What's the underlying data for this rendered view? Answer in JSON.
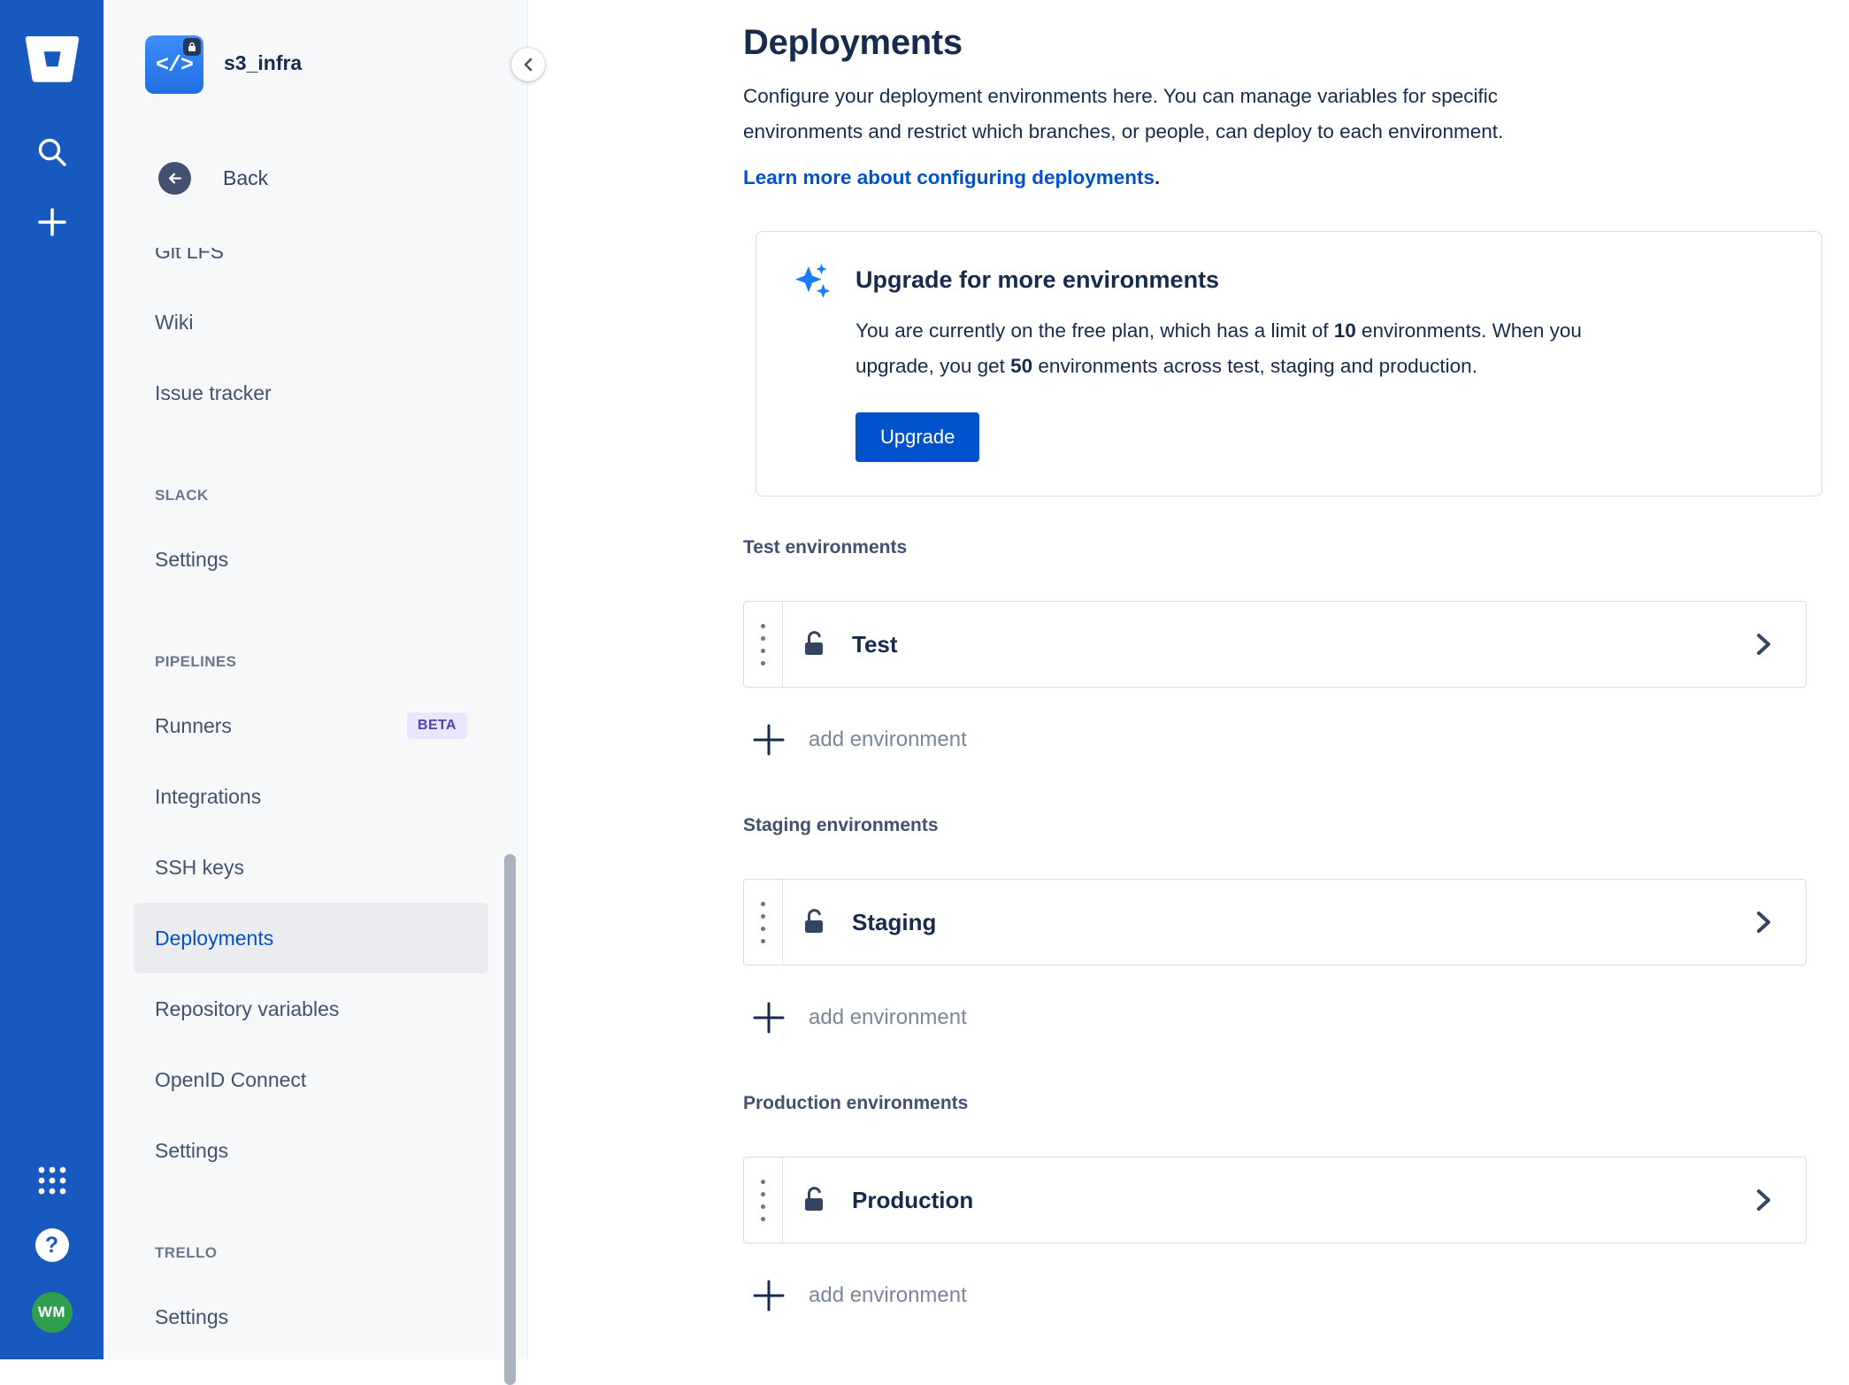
{
  "colors": {
    "rail_blue": "#1759BE",
    "accent_blue": "#0052CC",
    "heading_text": "#172B4D",
    "muted_text": "#6B778C",
    "beta_badge_bg": "#EAE6FF",
    "beta_badge_text": "#5243AA",
    "avatar_green": "#2E9E4F",
    "repo_avatar_blue": "#2684FF",
    "sparkle_blue": "#1D7AFC",
    "selected_item_bg": "#EBECF0"
  },
  "app_rail": {
    "logo": "bitbucket-logo",
    "icons": [
      "search-icon",
      "create-plus-icon",
      "apps-grid-icon",
      "help-icon"
    ],
    "avatar_initials": "WM"
  },
  "sidebar": {
    "repo_name": "s3_infra",
    "repo_avatar_glyph": "</>",
    "back_label": "Back",
    "top_items": [
      "Git LFS",
      "Wiki",
      "Issue tracker"
    ],
    "sections": [
      {
        "header": "SLACK",
        "items": [
          {
            "label": "Settings"
          }
        ]
      },
      {
        "header": "PIPELINES",
        "items": [
          {
            "label": "Runners",
            "badge": "BETA"
          },
          {
            "label": "Integrations"
          },
          {
            "label": "SSH keys"
          },
          {
            "label": "Deployments",
            "selected": true
          },
          {
            "label": "Repository variables"
          },
          {
            "label": "OpenID Connect"
          },
          {
            "label": "Settings"
          }
        ]
      },
      {
        "header": "TRELLO",
        "items": [
          {
            "label": "Settings"
          }
        ]
      }
    ]
  },
  "main": {
    "title": "Deployments",
    "description": "Configure your deployment environments here. You can manage variables for specific environments and restrict which branches, or people, can deploy to each environment.",
    "learn_more_link": "Learn more about configuring deployments",
    "learn_more_suffix": ".",
    "upgrade_card": {
      "title": "Upgrade for more environments",
      "body": {
        "seg1": "You are currently on the free plan, which has a limit of ",
        "free_limit": "10",
        "seg2": " environments. When you upgrade, you get ",
        "upgrade_limit": "50",
        "seg3": " environments across test, staging and production."
      },
      "button_label": "Upgrade"
    },
    "env_sections": [
      {
        "label": "Test environments",
        "row_label": "Test",
        "add_label": "add environment"
      },
      {
        "label": "Staging environments",
        "row_label": "Staging",
        "add_label": "add environment"
      },
      {
        "label": "Production environments",
        "row_label": "Production",
        "add_label": "add environment"
      }
    ]
  }
}
